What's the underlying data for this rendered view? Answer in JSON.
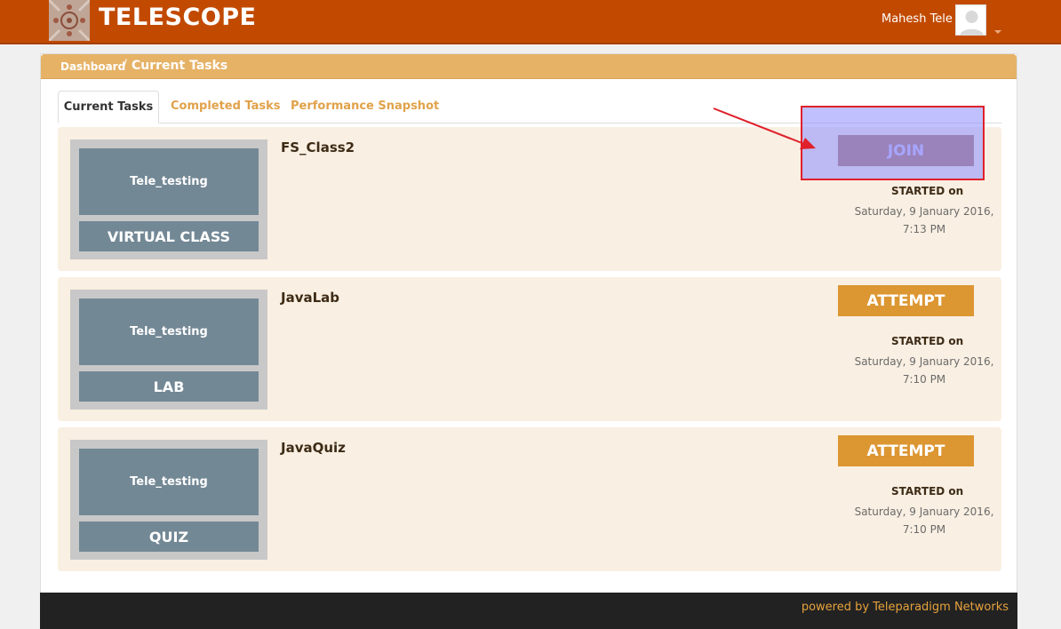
{
  "header": {
    "brand": "TELESCOPE",
    "user_name": "Mahesh Tele"
  },
  "breadcrumb": {
    "dashboard": "Dashboard",
    "separator": "/",
    "current": "Current Tasks"
  },
  "tabs": [
    {
      "label": "Current Tasks",
      "active": true
    },
    {
      "label": "Completed Tasks",
      "active": false
    },
    {
      "label": "Performance Snapshot",
      "active": false
    }
  ],
  "tasks": [
    {
      "owner": "Tele_testing",
      "type": "VIRTUAL CLASS",
      "title": "FS_Class2",
      "action": "JOIN",
      "started_label": "STARTED on",
      "started_date": "Saturday, 9 January 2016,",
      "started_time": "7:13 PM"
    },
    {
      "owner": "Tele_testing",
      "type": "LAB",
      "title": "JavaLab",
      "action": "ATTEMPT",
      "started_label": "STARTED on",
      "started_date": "Saturday, 9 January 2016,",
      "started_time": "7:10 PM"
    },
    {
      "owner": "Tele_testing",
      "type": "QUIZ",
      "title": "JavaQuiz",
      "action": "ATTEMPT",
      "started_label": "STARTED on",
      "started_date": "Saturday, 9 January 2016,",
      "started_time": "7:10 PM"
    }
  ],
  "footer": {
    "text": "powered by Teleparadigm Networks"
  },
  "colors": {
    "header": "#c24a00",
    "accent": "#dc9632",
    "card_bg": "#f9efe2",
    "thumb": "#738895",
    "highlight_border": "#e0202a"
  }
}
